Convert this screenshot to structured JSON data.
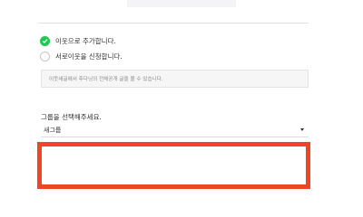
{
  "neighbor_options": [
    {
      "label": "이웃으로 추가합니다.",
      "checked": true,
      "icon": "check-icon"
    },
    {
      "label": "서로이웃을 신청합니다.",
      "checked": false
    }
  ],
  "notice": "이웃새글에서 후다닝의 전체공개 글을 볼 수 있습니다.",
  "group": {
    "heading": "그룹을 선택해주세요.",
    "selected": "새그룹"
  },
  "colors": {
    "accent": "#1fc754",
    "highlight": "#ee4523"
  }
}
